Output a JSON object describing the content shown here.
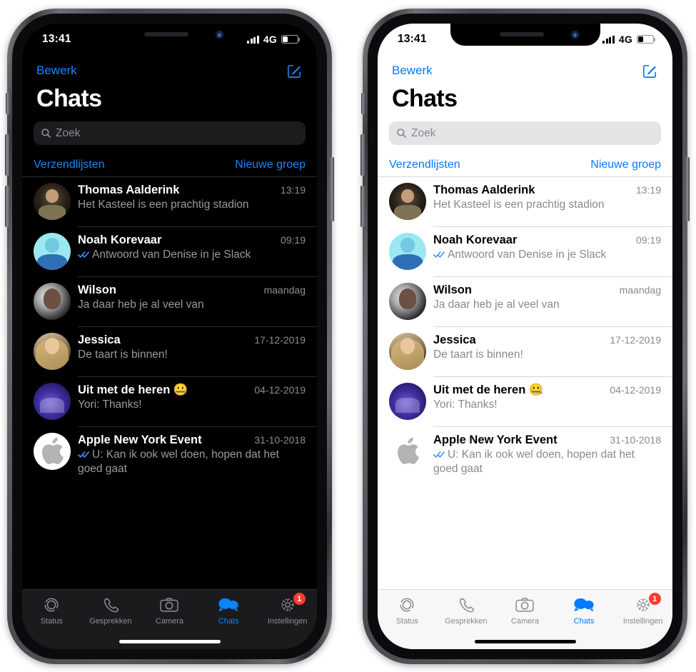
{
  "status_bar": {
    "time": "13:41",
    "carrier": "4G",
    "signal_icon": "cellular-bars-icon",
    "battery_icon": "battery-icon",
    "battery_level_percent": 30
  },
  "nav": {
    "edit_label": "Bewerk",
    "compose_icon": "compose-icon"
  },
  "header": {
    "title": "Chats"
  },
  "search": {
    "placeholder": "Zoek",
    "icon": "search-icon"
  },
  "actions": {
    "left_label": "Verzendlijsten",
    "right_label": "Nieuwe groep"
  },
  "chats": [
    {
      "name": "Thomas Aalderink",
      "time": "13:19",
      "message": "Het Kasteel is een prachtig stadion",
      "read_receipt": false,
      "avatar": "av-thomas",
      "avatar_name": "avatar-thomas-aalderink"
    },
    {
      "name": "Noah Korevaar",
      "time": "09:19",
      "message": "Antwoord van Denise in je Slack",
      "read_receipt": true,
      "avatar": "av-noah",
      "avatar_name": "avatar-noah-korevaar"
    },
    {
      "name": "Wilson",
      "time": "maandag",
      "message": "Ja daar heb je al veel van",
      "read_receipt": false,
      "avatar": "av-wilson",
      "avatar_name": "avatar-wilson"
    },
    {
      "name": "Jessica",
      "time": "17-12-2019",
      "message": "De taart is binnen!",
      "read_receipt": false,
      "avatar": "av-jessica",
      "avatar_name": "avatar-jessica"
    },
    {
      "name": "Uit met de heren 🤐",
      "time": "04-12-2019",
      "message": "Yori: Thanks!",
      "read_receipt": false,
      "avatar": "av-uit",
      "avatar_name": "avatar-uit-met-de-heren"
    },
    {
      "name": "Apple New York Event",
      "time": "31-10-2018",
      "message": "U: Kan ik ook wel doen, hopen dat het goed gaat",
      "read_receipt": true,
      "avatar": "av-apple",
      "avatar_name": "avatar-apple-new-york-event"
    }
  ],
  "tabs": [
    {
      "label": "Status",
      "icon": "status-rings-icon",
      "active": false,
      "badge": null
    },
    {
      "label": "Gesprekken",
      "icon": "phone-icon",
      "active": false,
      "badge": null
    },
    {
      "label": "Camera",
      "icon": "camera-icon",
      "active": false,
      "badge": null
    },
    {
      "label": "Chats",
      "icon": "chat-bubbles-icon",
      "active": true,
      "badge": null
    },
    {
      "label": "Instellingen",
      "icon": "gear-icon",
      "active": false,
      "badge": "1"
    }
  ],
  "colors": {
    "accent_dark": "#1a85ff",
    "accent_light": "#007aff",
    "badge_red": "#ff3b30",
    "read_tick_blue": "#3b8cf0",
    "dark_bg": "#000000",
    "light_bg": "#ffffff"
  },
  "variants": [
    {
      "id": "dark",
      "theme_name": "dark-mode-phone"
    },
    {
      "id": "light",
      "theme_name": "light-mode-phone"
    }
  ]
}
